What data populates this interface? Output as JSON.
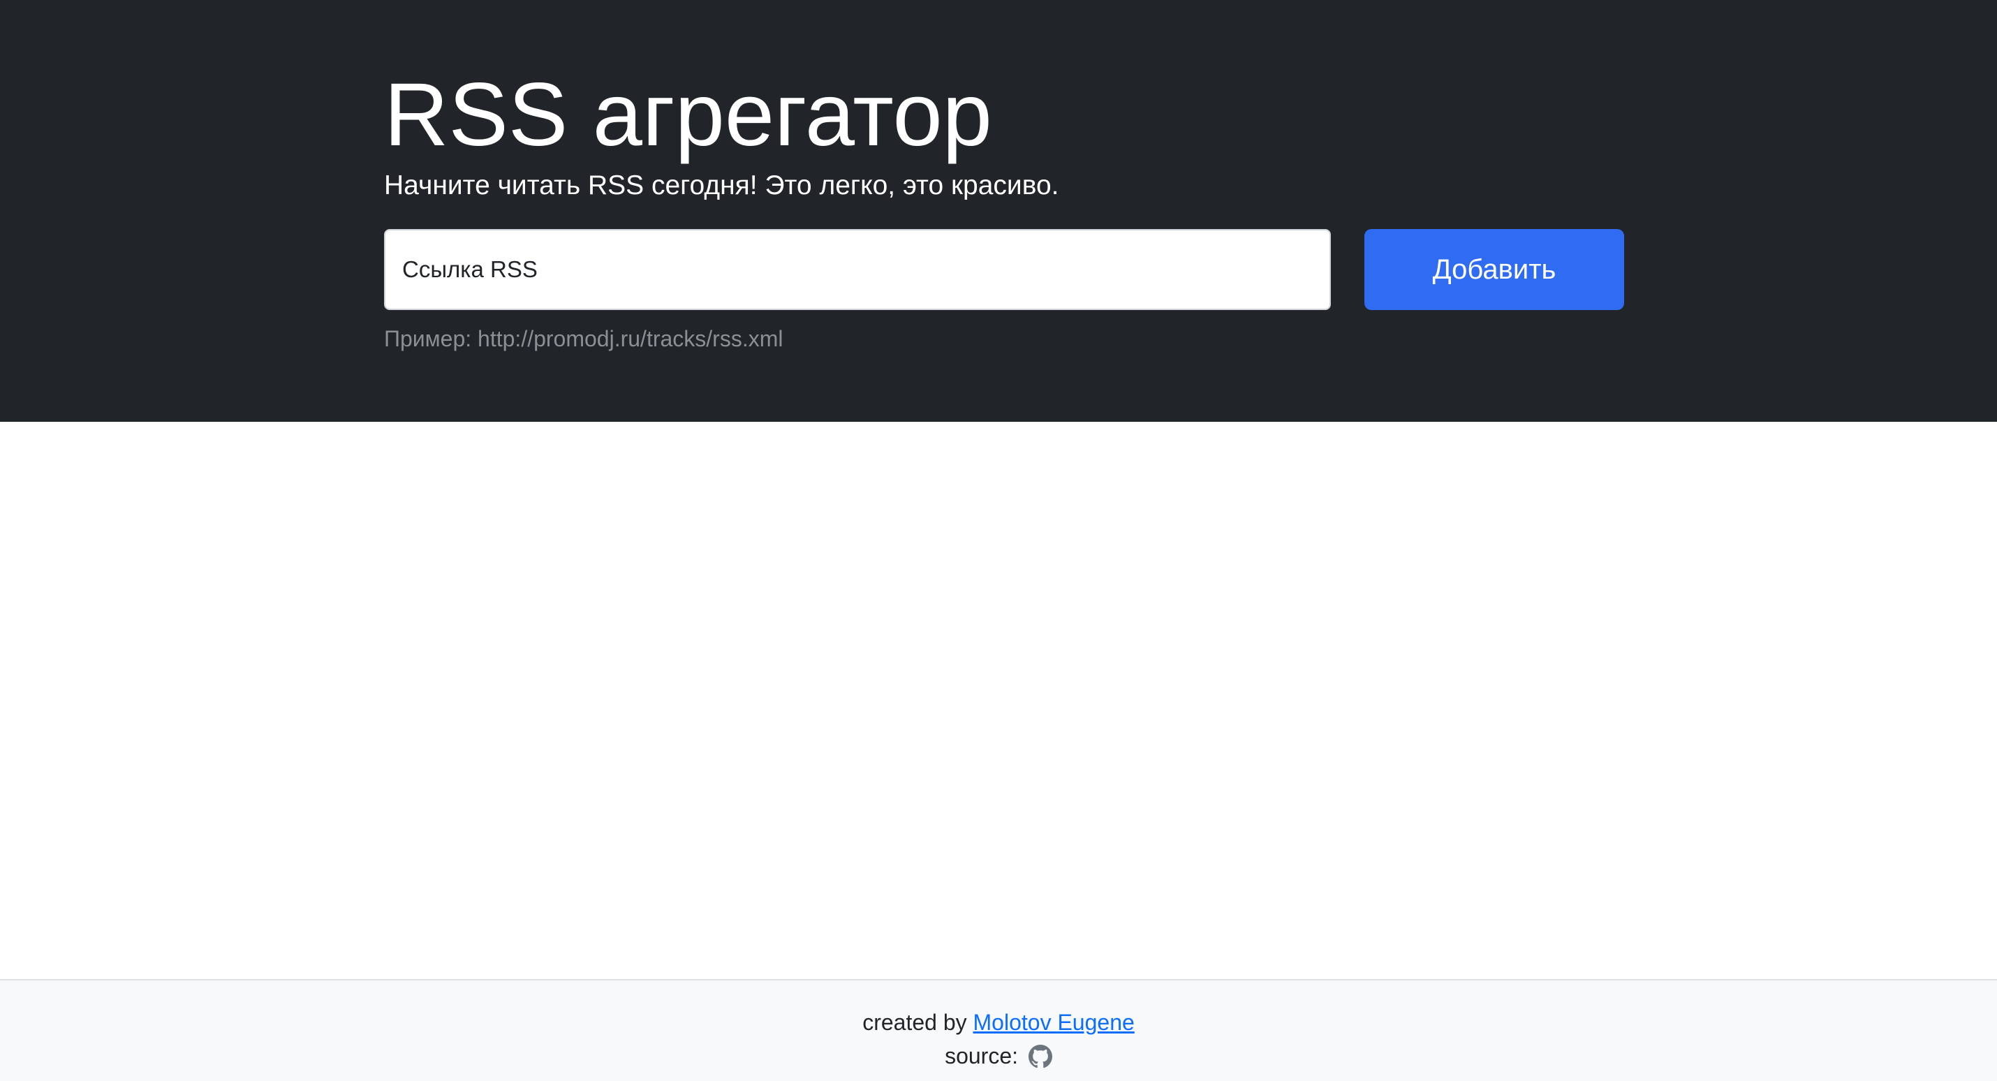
{
  "header": {
    "title": "RSS агрегатор",
    "lead": "Начните читать RSS сегодня! Это легко, это красиво."
  },
  "form": {
    "input_placeholder": "Ссылка RSS",
    "input_value": "",
    "submit_label": "Добавить",
    "example_hint": "Пример: http://promodj.ru/tracks/rss.xml"
  },
  "footer": {
    "created_by_prefix": "created by ",
    "author_name": "Molotov Eugene",
    "source_prefix": "source: ",
    "source_icon": "github-icon"
  },
  "colors": {
    "hero_background": "#212529",
    "primary_button": "#306cf2",
    "footer_background": "#f8f9fa",
    "link": "#0d6efd"
  }
}
